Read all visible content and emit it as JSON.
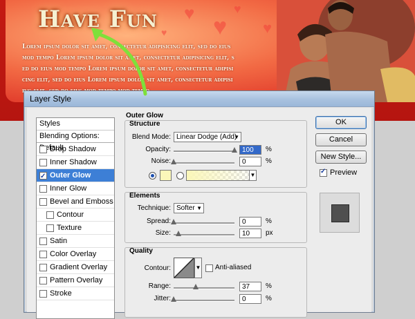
{
  "banner": {
    "title": "Have Fun",
    "lorem_lines": [
      "Lorem ipsum dolor sit amet, consectetur adipisicing elit, sed do eius",
      "mod tempo Lorem ipsum dolor sit amet, consectetur adipisicing elit, s",
      "ed do eius mod tempo Lorem ipsum dolor sit amet, consectetur adipisi",
      "cing elit, sed do eius Lorem ipsum dolor sit amet, consectetur adipisi",
      "ing elit, sed do eius mod tempo mod tempo"
    ]
  },
  "dialog": {
    "title": "Layer Style",
    "styles_list": {
      "header": "Styles",
      "blending": "Blending Options: Default",
      "items": [
        {
          "label": "Drop Shadow",
          "checked": false,
          "indent": false,
          "selected": false
        },
        {
          "label": "Inner Shadow",
          "checked": false,
          "indent": false,
          "selected": false
        },
        {
          "label": "Outer Glow",
          "checked": true,
          "indent": false,
          "selected": true
        },
        {
          "label": "Inner Glow",
          "checked": false,
          "indent": false,
          "selected": false
        },
        {
          "label": "Bevel and Emboss",
          "checked": false,
          "indent": false,
          "selected": false
        },
        {
          "label": "Contour",
          "checked": false,
          "indent": true,
          "selected": false
        },
        {
          "label": "Texture",
          "checked": false,
          "indent": true,
          "selected": false
        },
        {
          "label": "Satin",
          "checked": false,
          "indent": false,
          "selected": false
        },
        {
          "label": "Color Overlay",
          "checked": false,
          "indent": false,
          "selected": false
        },
        {
          "label": "Gradient Overlay",
          "checked": false,
          "indent": false,
          "selected": false
        },
        {
          "label": "Pattern Overlay",
          "checked": false,
          "indent": false,
          "selected": false
        },
        {
          "label": "Stroke",
          "checked": false,
          "indent": false,
          "selected": false
        }
      ]
    },
    "panel": {
      "heading": "Outer Glow",
      "structure": {
        "title": "Structure",
        "blend_mode_label": "Blend Mode:",
        "blend_mode_value": "Linear Dodge (Add)",
        "opacity_label": "Opacity:",
        "opacity_value": "100",
        "noise_label": "Noise:",
        "noise_value": "0",
        "percent": "%",
        "glow_color": "#fbf7b9"
      },
      "elements": {
        "title": "Elements",
        "technique_label": "Technique:",
        "technique_value": "Softer",
        "spread_label": "Spread:",
        "spread_value": "0",
        "size_label": "Size:",
        "size_value": "10",
        "percent": "%",
        "px": "px"
      },
      "quality": {
        "title": "Quality",
        "contour_label": "Contour:",
        "antialiased_label": "Anti-aliased",
        "range_label": "Range:",
        "range_value": "37",
        "jitter_label": "Jitter:",
        "jitter_value": "0",
        "percent": "%"
      }
    },
    "buttons": {
      "ok": "OK",
      "cancel": "Cancel",
      "new_style": "New Style...",
      "preview_label": "Preview",
      "preview_checked": true
    }
  },
  "colors": {
    "selection": "#3d7fd6",
    "arrow": "#7ee03a",
    "banner_red": "#c41a12"
  }
}
